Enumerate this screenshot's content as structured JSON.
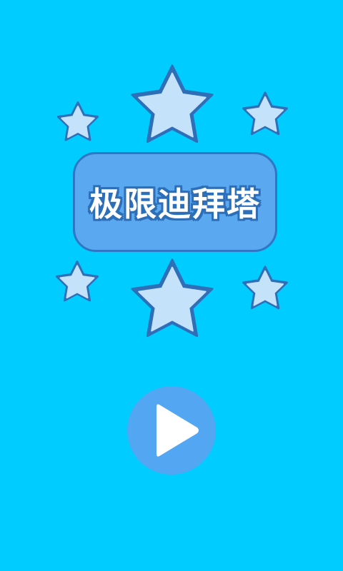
{
  "title": "极限迪拜塔",
  "colors": {
    "background": "#00ccff",
    "panel": "#5aa8f0",
    "panel_border": "#2f76c4",
    "star_fill": "#c5e2fb",
    "star_border": "#2f6fb8",
    "play_button": "#52a6f2",
    "play_icon": "#ffffff"
  },
  "icons": {
    "play": "play-icon",
    "star": "star-icon"
  }
}
